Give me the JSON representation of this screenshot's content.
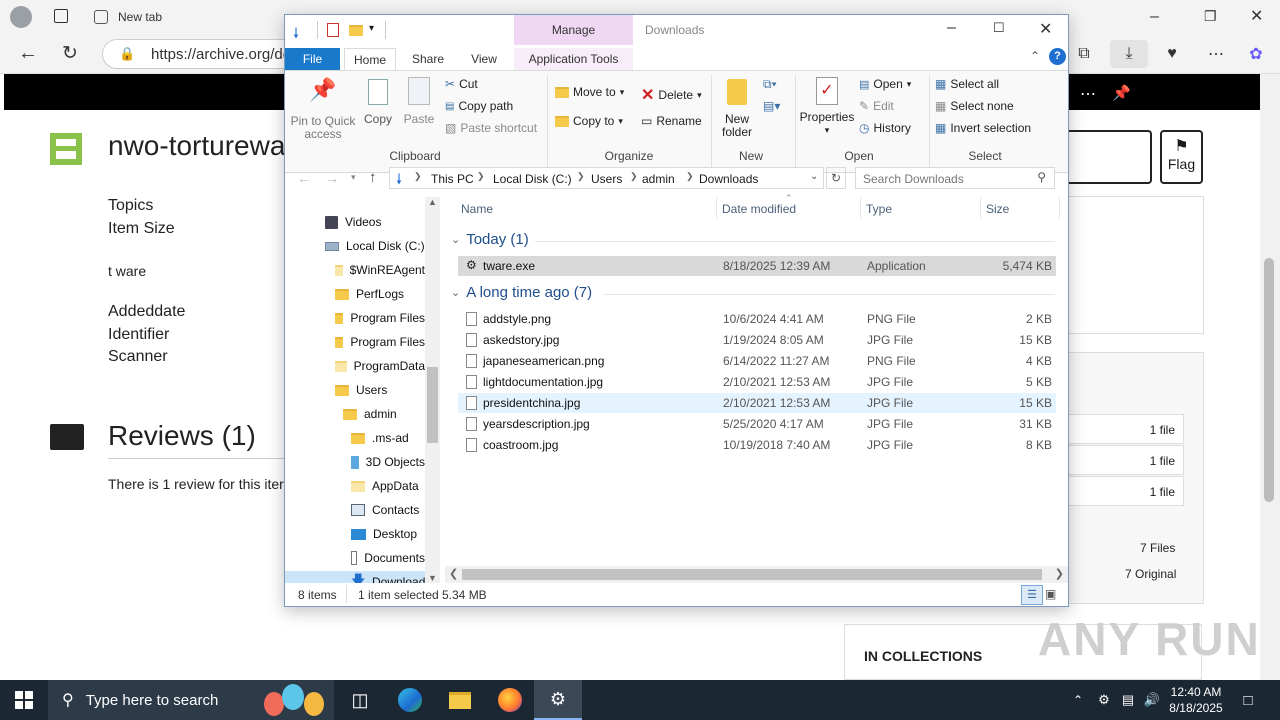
{
  "browser": {
    "new_tab": "New tab",
    "url": "https://archive.org/de"
  },
  "page": {
    "item_title": "nwo-torturewa",
    "topics": "Topics",
    "item_size": "Item Size",
    "t_ware": "t ware",
    "addeddate": "Addeddate",
    "identifier": "Identifier",
    "scanner": "Scanner",
    "reviews": "Reviews (1)",
    "review_text": "There is 1 review for this iter",
    "flag": "Flag",
    "file1": "1 file",
    "file2": "1 file",
    "file3": "1 file",
    "files_total": "7 Files",
    "original": "7 Original",
    "in_collections": "IN COLLECTIONS",
    "watermark": "ANY RUN"
  },
  "explorer": {
    "title": "Downloads",
    "manage": "Manage",
    "tabs": [
      "File",
      "Home",
      "Share",
      "View",
      "Application Tools"
    ],
    "clipboard": {
      "pin": [
        "Pin to Quick",
        "access"
      ],
      "copy": "Copy",
      "paste": "Paste",
      "cut": "Cut",
      "copy_path": "Copy path",
      "paste_shortcut": "Paste shortcut",
      "label": "Clipboard"
    },
    "organize": {
      "move_to": "Move to",
      "copy_to": "Copy to",
      "delete": "Delete",
      "rename": "Rename",
      "label": "Organize"
    },
    "new": {
      "new_folder": [
        "New",
        "folder"
      ],
      "label": "New"
    },
    "open": {
      "properties": "Properties",
      "open": "Open",
      "edit": "Edit",
      "history": "History",
      "label": "Open"
    },
    "select": {
      "select_all": "Select all",
      "select_none": "Select none",
      "invert": "Invert selection",
      "label": "Select"
    },
    "breadcrumb": [
      "This PC",
      "Local Disk (C:)",
      "Users",
      "admin",
      "Downloads"
    ],
    "search_placeholder": "Search Downloads",
    "nav": [
      "Videos",
      "Local Disk (C:)",
      "$WinREAgent",
      "PerfLogs",
      "Program Files",
      "Program Files",
      "ProgramData",
      "Users",
      "admin",
      ".ms-ad",
      "3D Objects",
      "AppData",
      "Contacts",
      "Desktop",
      "Documents",
      "Downloads"
    ],
    "columns": {
      "name": "Name",
      "date": "Date modified",
      "type": "Type",
      "size": "Size"
    },
    "group_today": "Today (1)",
    "group_old": "A long time ago (7)",
    "today_files": [
      {
        "name": "tware.exe",
        "date": "8/18/2025 12:39 AM",
        "type": "Application",
        "size": "5,474 KB"
      }
    ],
    "old_files": [
      {
        "name": "addstyle.png",
        "date": "10/6/2024 4:41 AM",
        "type": "PNG File",
        "size": "2 KB"
      },
      {
        "name": "askedstory.jpg",
        "date": "1/19/2024 8:05 AM",
        "type": "JPG File",
        "size": "15 KB"
      },
      {
        "name": "japaneseamerican.png",
        "date": "6/14/2022 11:27 AM",
        "type": "PNG File",
        "size": "4 KB"
      },
      {
        "name": "lightdocumentation.jpg",
        "date": "2/10/2021 12:53 AM",
        "type": "JPG File",
        "size": "5 KB"
      },
      {
        "name": "presidentchina.jpg",
        "date": "2/10/2021 12:53 AM",
        "type": "JPG File",
        "size": "15 KB"
      },
      {
        "name": "yearsdescription.jpg",
        "date": "5/25/2020 4:17 AM",
        "type": "JPG File",
        "size": "31 KB"
      },
      {
        "name": "coastroom.jpg",
        "date": "10/19/2018 7:40 AM",
        "type": "JPG File",
        "size": "8 KB"
      }
    ],
    "status": {
      "items": "8 items",
      "selected": "1 item selected",
      "size": "5.34 MB"
    }
  },
  "taskbar": {
    "search_placeholder": "Type here to search",
    "time": "12:40 AM",
    "date": "8/18/2025"
  }
}
